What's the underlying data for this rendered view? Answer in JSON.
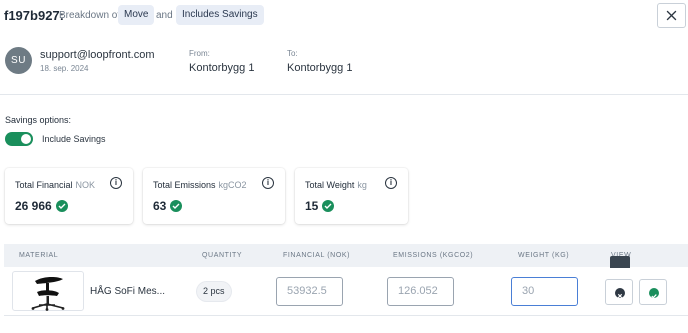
{
  "header": {
    "id": "f197b927:",
    "breakdown_label": "Breakdown of",
    "tag_move": "Move",
    "and_label": "and",
    "tag_savings": "Includes Savings",
    "close_icon": "close-icon"
  },
  "user": {
    "initials": "SU",
    "email": "support@loopfront.com",
    "date": "18. sep. 2024"
  },
  "route": {
    "from_label": "From:",
    "from_value": "Kontorbygg 1",
    "to_label": "To:",
    "to_value": "Kontorbygg 1"
  },
  "savings": {
    "title": "Savings options:",
    "toggle_label": "Include Savings",
    "enabled": true
  },
  "cards": [
    {
      "title": "Total Financial",
      "unit": "NOK",
      "value": "26 966",
      "info": "i"
    },
    {
      "title": "Total Emissions",
      "unit": "kgCO2",
      "value": "63",
      "info": "i"
    },
    {
      "title": "Total Weight",
      "unit": "kg",
      "value": "15",
      "info": "i"
    }
  ],
  "table": {
    "headers": {
      "material": "MATERIAL",
      "quantity": "QUANTITY",
      "financial": "FINANCIAL (NOK)",
      "emissions": "EMISSIONS (KGCO2)",
      "weight": "WEIGHT (KG)",
      "view": "VIEW"
    },
    "rows": [
      {
        "name": "HÅG SoFi Mes...",
        "quantity": "2 pcs",
        "financial_placeholder": "53932.5",
        "emissions_placeholder": "126.052",
        "weight_placeholder": "30"
      }
    ]
  },
  "colors": {
    "accent_green": "#1a8f5c",
    "tag_bg": "#e8edf6",
    "header_bg": "#eef1f5",
    "active_border": "#4a7fd6"
  }
}
